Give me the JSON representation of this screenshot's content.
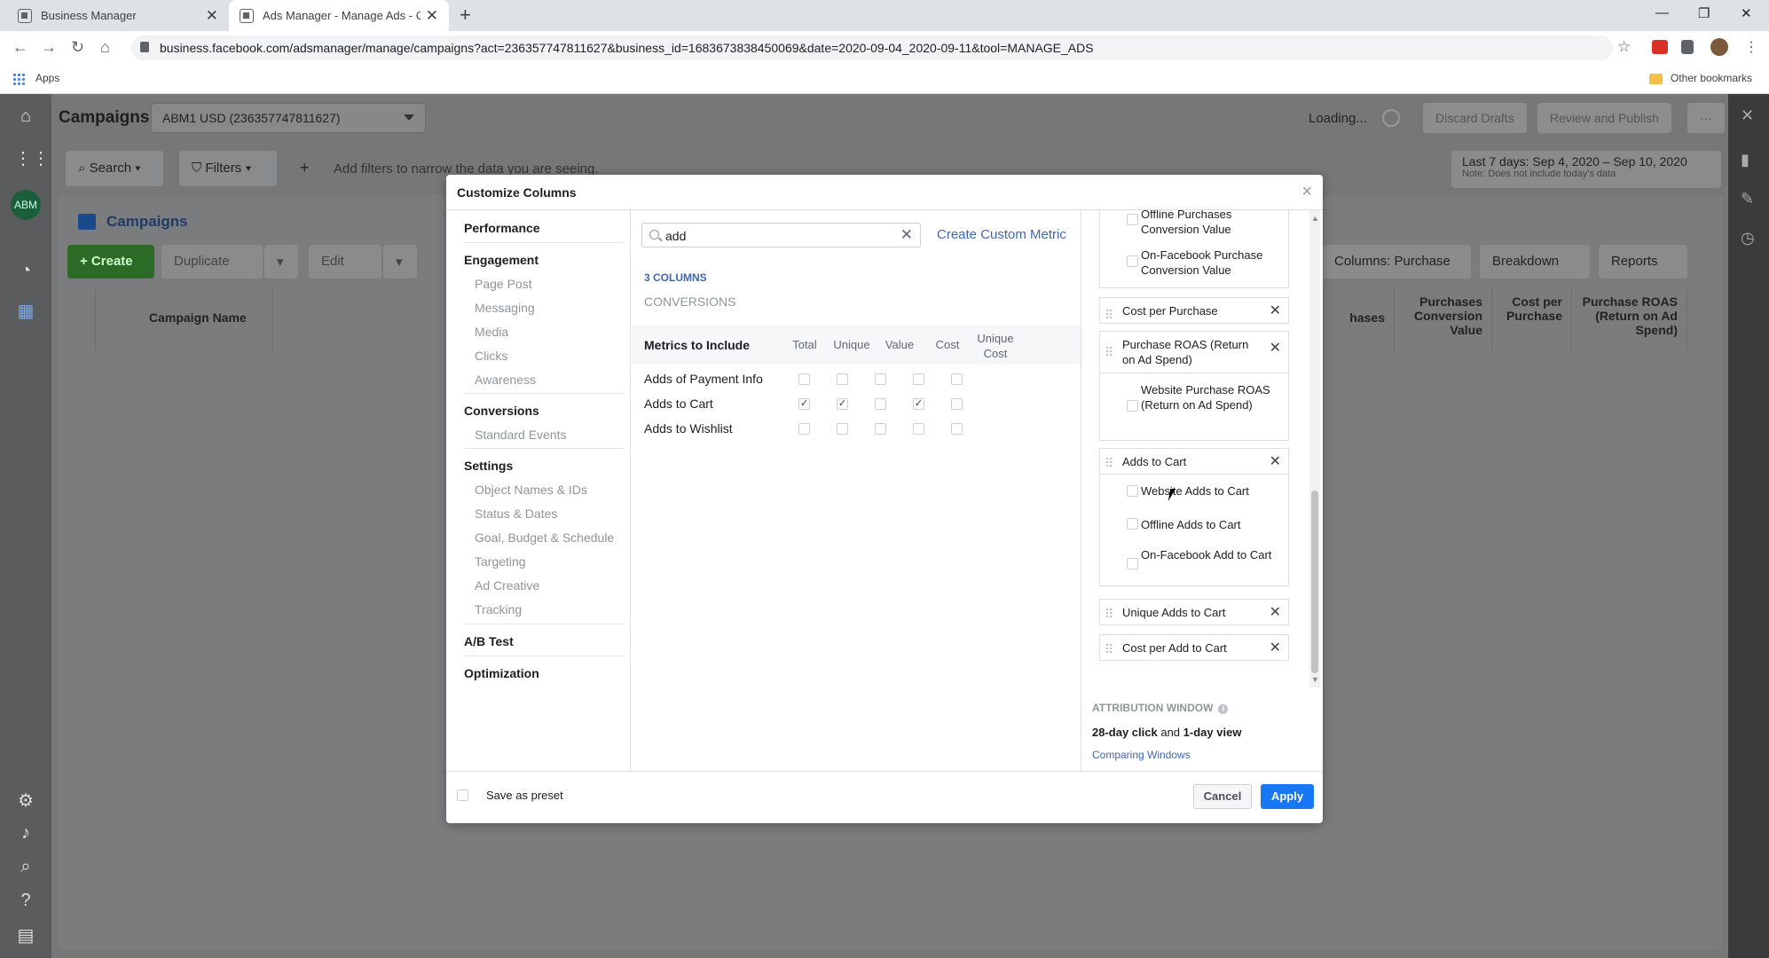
{
  "browser": {
    "tabs": [
      {
        "label": "Business Manager"
      },
      {
        "label": "Ads Manager - Manage Ads - Ca"
      }
    ],
    "url": "business.facebook.com/adsmanager/manage/campaigns?act=236357747811627&business_id=1683673838450069&date=2020-09-04_2020-09-11&tool=MANAGE_ADS",
    "bookmarks": {
      "apps": "Apps",
      "other": "Other bookmarks"
    }
  },
  "app": {
    "avatar": "ABM",
    "title": "Campaigns",
    "account": "ABM1 USD (236357747811627)",
    "loading": "Loading...",
    "discard": "Discard Drafts",
    "review": "Review and Publish",
    "more": "···",
    "search": "Search",
    "filters": "Filters",
    "filter_hint": "Add filters to narrow the data you are seeing.",
    "date_range": "Last 7 days: Sep 4, 2020 – Sep 10, 2020",
    "date_note": "Note: Does not include today's data",
    "campaigns_tab": "Campaigns",
    "create": "+ Create",
    "duplicate": "Duplicate",
    "edit": "Edit",
    "columns": "Columns: Purchase",
    "breakdown": "Breakdown",
    "reports": "Reports",
    "table_headers": {
      "campaign_name": "Campaign Name",
      "hases": "hases",
      "purch_conv": "Purchases Conversion Value",
      "cost_per_purchase": "Cost per Purchase",
      "purch_roas": "Purchase ROAS (Return on Ad Spend)"
    }
  },
  "modal": {
    "title": "Customize Columns",
    "nav": {
      "performance": "Performance",
      "engagement": "Engagement",
      "engagement_items": [
        "Page Post",
        "Messaging",
        "Media",
        "Clicks",
        "Awareness"
      ],
      "conversions": "Conversions",
      "conversions_items": [
        "Standard Events"
      ],
      "settings": "Settings",
      "settings_items": [
        "Object Names & IDs",
        "Status & Dates",
        "Goal, Budget & Schedule",
        "Targeting",
        "Ad Creative",
        "Tracking"
      ],
      "ab_test": "A/B Test",
      "optimization": "Optimization"
    },
    "search_value": "add",
    "create_custom_metric": "Create Custom Metric",
    "column_count": "3 COLUMNS",
    "category": "CONVERSIONS",
    "metrics_header": "Metrics to Include",
    "metric_columns": [
      "Total",
      "Unique",
      "Value",
      "Cost",
      "Unique Cost"
    ],
    "metrics": [
      {
        "name": "Adds of Payment Info",
        "checked": [
          false,
          false,
          false,
          false,
          false
        ]
      },
      {
        "name": "Adds to Cart",
        "checked": [
          true,
          true,
          false,
          true,
          false
        ]
      },
      {
        "name": "Adds to Wishlist",
        "checked": [
          false,
          false,
          false,
          false,
          false
        ]
      }
    ],
    "selected": {
      "offline_purch_value": "Offline Purchases Conversion Value",
      "onfb_purch_value": "On-Facebook Purchase Conversion Value",
      "cost_per_purchase": "Cost per Purchase",
      "purchase_roas": "Purchase ROAS (Return on Ad Spend)",
      "website_purchase_roas": "Website Purchase ROAS (Return on Ad Spend)",
      "adds_to_cart": "Adds to Cart",
      "website_adds_to_cart": "Website Adds to Cart",
      "offline_adds_to_cart": "Offline Adds to Cart",
      "onfb_add_to_cart": "On-Facebook Add to Cart",
      "unique_adds_to_cart": "Unique Adds to Cart",
      "cost_per_add_to_cart": "Cost per Add to Cart"
    },
    "attribution_label": "ATTRIBUTION WINDOW",
    "attribution_click": "28-day click",
    "attribution_and": "and",
    "attribution_view": "1-day view",
    "comparing_windows": "Comparing Windows",
    "save_preset": "Save as preset",
    "cancel": "Cancel",
    "apply": "Apply"
  }
}
